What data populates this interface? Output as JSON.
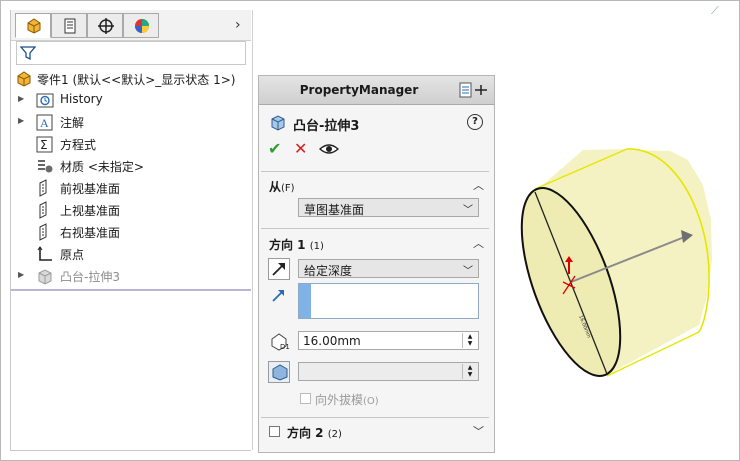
{
  "featuremanager": {
    "tabs": [
      "featuremanager-tree",
      "property-manager",
      "configuration-manager",
      "appearance-manager"
    ],
    "more_tabs_glyph": "›",
    "root_label": "零件1 (默认<<默认>_显示状态 1>)",
    "items": [
      {
        "label": "History",
        "icon": "history-icon",
        "expandable": true
      },
      {
        "label": "注解",
        "icon": "annotations-icon",
        "expandable": true
      },
      {
        "label": "方程式",
        "icon": "equations-icon",
        "expandable": false
      },
      {
        "label": "材质 <未指定>",
        "icon": "material-icon",
        "expandable": false
      },
      {
        "label": "前视基准面",
        "icon": "plane-icon",
        "expandable": false
      },
      {
        "label": "上视基准面",
        "icon": "plane-icon",
        "expandable": false
      },
      {
        "label": "右视基准面",
        "icon": "plane-icon",
        "expandable": false
      },
      {
        "label": "原点",
        "icon": "origin-icon",
        "expandable": false
      },
      {
        "label": "凸台-拉伸3",
        "icon": "extrude-icon",
        "expandable": true,
        "greyed": true
      }
    ]
  },
  "property_manager": {
    "title": "PropertyManager",
    "feature_name": "凸台-拉伸3",
    "help_glyph": "?",
    "actions": {
      "ok": "✔",
      "cancel": "✕",
      "preview": "👁"
    },
    "from": {
      "title": "从",
      "shortcut": "(F)",
      "value": "草图基准面"
    },
    "direction1": {
      "title": "方向 1",
      "shortcut": "(1)",
      "end_condition": "给定深度",
      "depth": "16.00mm",
      "draft_outward_label": "向外拔模",
      "draft_outward_shortcut": "(O)"
    },
    "direction2": {
      "title": "方向 2",
      "shortcut": "(2)"
    }
  },
  "colors": {
    "accent_blue": "#7fb3e8",
    "ok_green": "#2e9e2e",
    "cancel_red": "#d42020",
    "cylinder_face": "#f4f2c2",
    "cylinder_edge": "#e6e600"
  }
}
